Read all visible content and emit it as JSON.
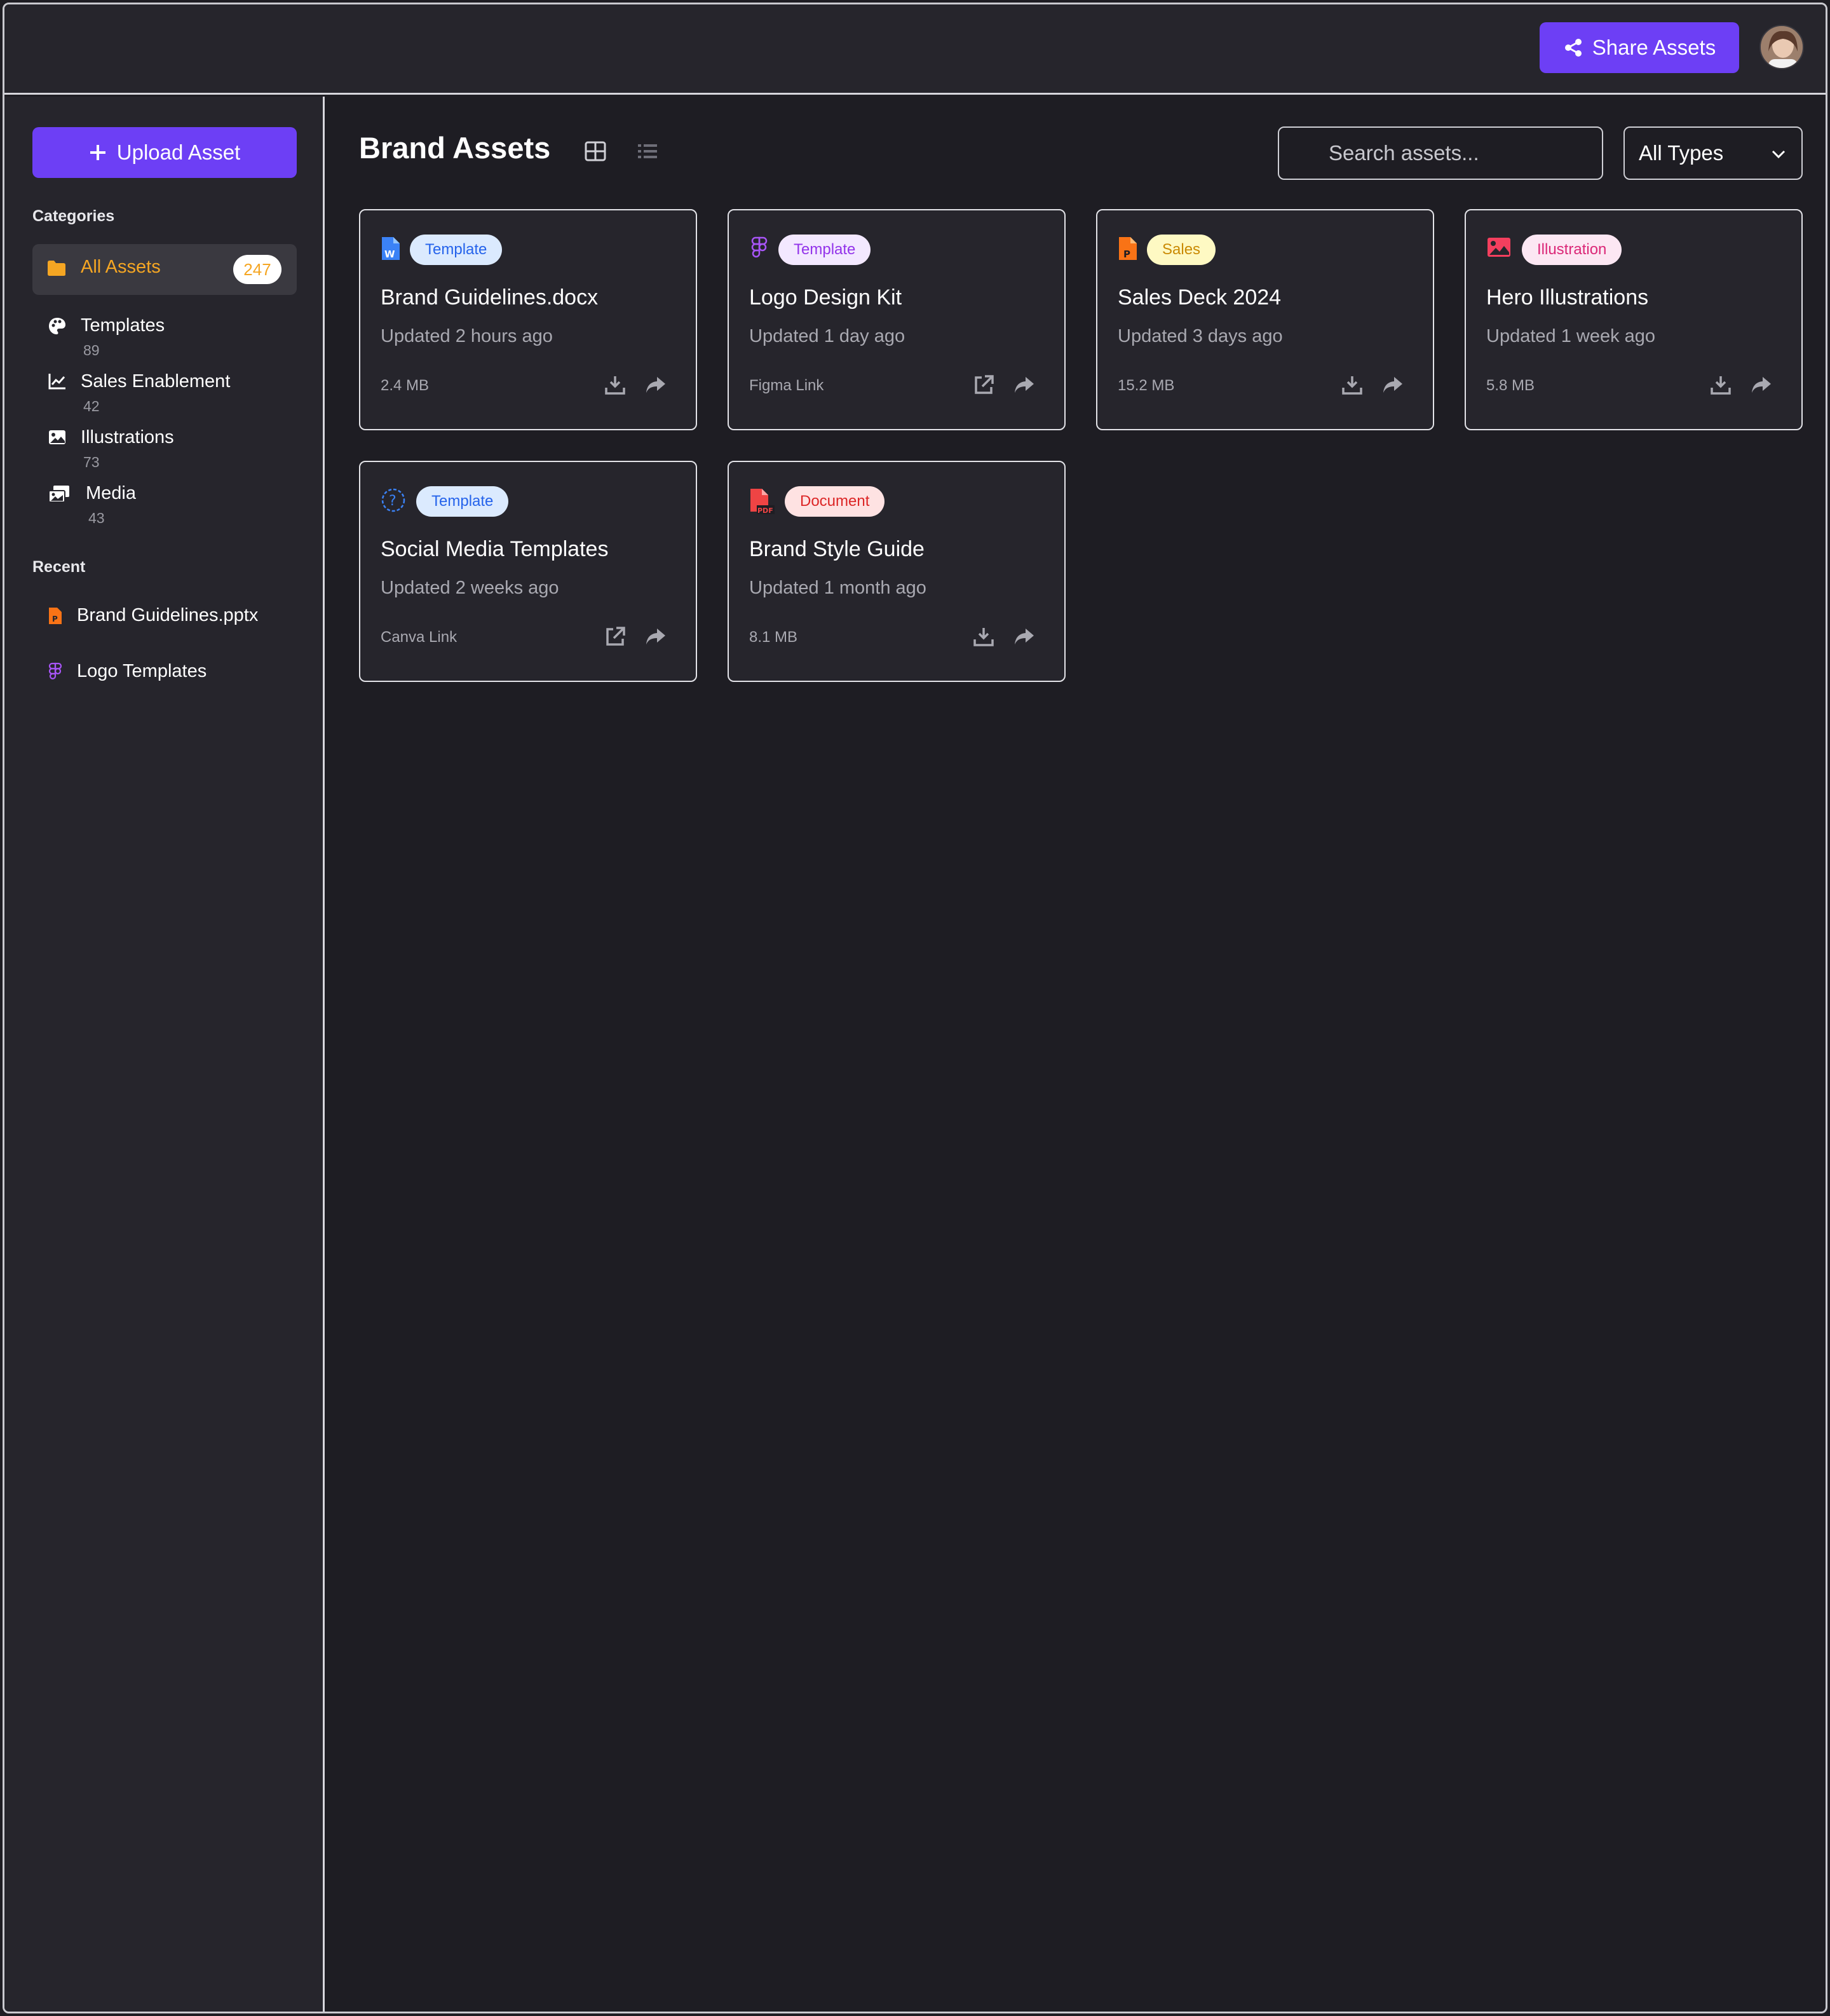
{
  "header": {
    "share_label": "Share Assets"
  },
  "sidebar": {
    "upload_label": "Upload Asset",
    "categories_heading": "Categories",
    "all_assets": {
      "label": "All Assets",
      "count": "247"
    },
    "categories": [
      {
        "label": "Templates",
        "count": "89",
        "icon": "palette-icon"
      },
      {
        "label": "Sales Enablement",
        "count": "42",
        "icon": "chart-line-icon"
      },
      {
        "label": "Illustrations",
        "count": "73",
        "icon": "image-icon"
      },
      {
        "label": "Media",
        "count": "43",
        "icon": "photo-video-icon"
      }
    ],
    "recent_heading": "Recent",
    "recent": [
      {
        "label": "Brand Guidelines.pptx",
        "icon": "powerpoint-file-icon"
      },
      {
        "label": "Logo Templates",
        "icon": "figma-icon"
      }
    ]
  },
  "main": {
    "title": "Brand Assets",
    "search_placeholder": "Search assets...",
    "type_filter": "All Types",
    "cards": [
      {
        "badge": "Template",
        "title": "Brand Guidelines.docx",
        "updated": "Updated 2 hours ago",
        "meta": "2.4 MB",
        "icon": "word-file-icon",
        "action": "download-icon"
      },
      {
        "badge": "Template",
        "title": "Logo Design Kit",
        "updated": "Updated 1 day ago",
        "meta": "Figma Link",
        "icon": "figma-icon",
        "action": "external-link-icon"
      },
      {
        "badge": "Sales",
        "title": "Sales Deck 2024",
        "updated": "Updated 3 days ago",
        "meta": "15.2 MB",
        "icon": "powerpoint-file-icon",
        "action": "download-icon"
      },
      {
        "badge": "Illustration",
        "title": "Hero Illustrations",
        "updated": "Updated 1 week ago",
        "meta": "5.8 MB",
        "icon": "image-icon",
        "action": "download-icon"
      },
      {
        "badge": "Template",
        "title": "Social Media Templates",
        "updated": "Updated 2 weeks ago",
        "meta": "Canva Link",
        "icon": "question-circle-icon",
        "action": "external-link-icon"
      },
      {
        "badge": "Document",
        "title": "Brand Style Guide",
        "updated": "Updated 1 month ago",
        "meta": "8.1 MB",
        "icon": "pdf-file-icon",
        "action": "download-icon"
      }
    ]
  },
  "colors": {
    "accent": "#6d3ff5",
    "active_category": "#f5a623",
    "badge_blue_bg": "#dbeafe",
    "badge_blue_text": "#2563eb",
    "badge_purple_bg": "#f3e8ff",
    "badge_purple_text": "#9333ea",
    "badge_yellow_bg": "#fef9c3",
    "badge_yellow_text": "#ca8a04",
    "badge_pink_bg": "#fce7f3",
    "badge_pink_text": "#db2777",
    "badge_red_bg": "#fee2e2",
    "badge_red_text": "#dc2626"
  }
}
